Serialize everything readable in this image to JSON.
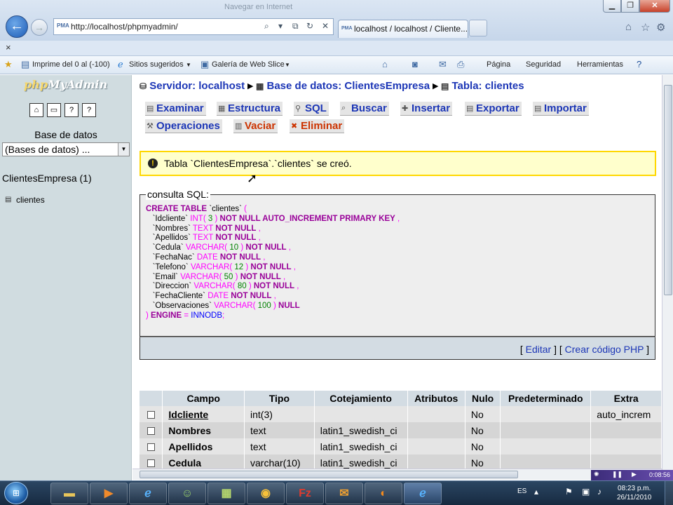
{
  "browser": {
    "window_title": "Navegar en Internet",
    "url": "http://localhost/phpmyadmin/",
    "favicon_text": "PMA",
    "tab_title": "localhost / localhost / Cliente...",
    "favorites_bar": {
      "close": "×",
      "items": [
        "Imprime del 0 al (-100)",
        "Sitios sugeridos",
        "Galería de Web Slice"
      ]
    },
    "command_bar": [
      "Página",
      "Seguridad",
      "Herramientas"
    ]
  },
  "left": {
    "logo_php": "php",
    "logo_myadmin": "MyAdmin",
    "db_label": "Base de datos",
    "db_select": "(Bases de datos) ...",
    "db_current": "ClientesEmpresa (1)",
    "table_link": "clientes"
  },
  "breadcrumb": {
    "server": "Servidor: localhost",
    "database": "Base de datos: ClientesEmpresa",
    "table": "Tabla: clientes"
  },
  "tabs": [
    "Examinar",
    "Estructura",
    "SQL",
    "Buscar",
    "Insertar",
    "Exportar",
    "Importar",
    "Operaciones",
    "Vaciar",
    "Eliminar"
  ],
  "notice": {
    "text": "Tabla `ClientesEmpresa`.`clientes` se creó."
  },
  "sql_box": {
    "legend": "consulta SQL:",
    "links": {
      "edit": "Editar",
      "php": "Crear código PHP"
    }
  },
  "fields_table": {
    "headers": [
      "Campo",
      "Tipo",
      "Cotejamiento",
      "Atributos",
      "Nulo",
      "Predeterminado",
      "Extra"
    ],
    "rows": [
      {
        "field": "Idcliente",
        "type": "int(3)",
        "collation": "",
        "attributes": "",
        "null": "No",
        "default": "",
        "extra": "auto_increm"
      },
      {
        "field": "Nombres",
        "type": "text",
        "collation": "latin1_swedish_ci",
        "attributes": "",
        "null": "No",
        "default": "",
        "extra": ""
      },
      {
        "field": "Apellidos",
        "type": "text",
        "collation": "latin1_swedish_ci",
        "attributes": "",
        "null": "No",
        "default": "",
        "extra": ""
      },
      {
        "field": "Cedula",
        "type": "varchar(10)",
        "collation": "latin1_swedish_ci",
        "attributes": "",
        "null": "No",
        "default": "",
        "extra": ""
      }
    ]
  },
  "media_overlay": {
    "time": "0:08:56"
  },
  "taskbar": {
    "language": "ES",
    "time": "08:23 p.m.",
    "date": "26/11/2010"
  }
}
